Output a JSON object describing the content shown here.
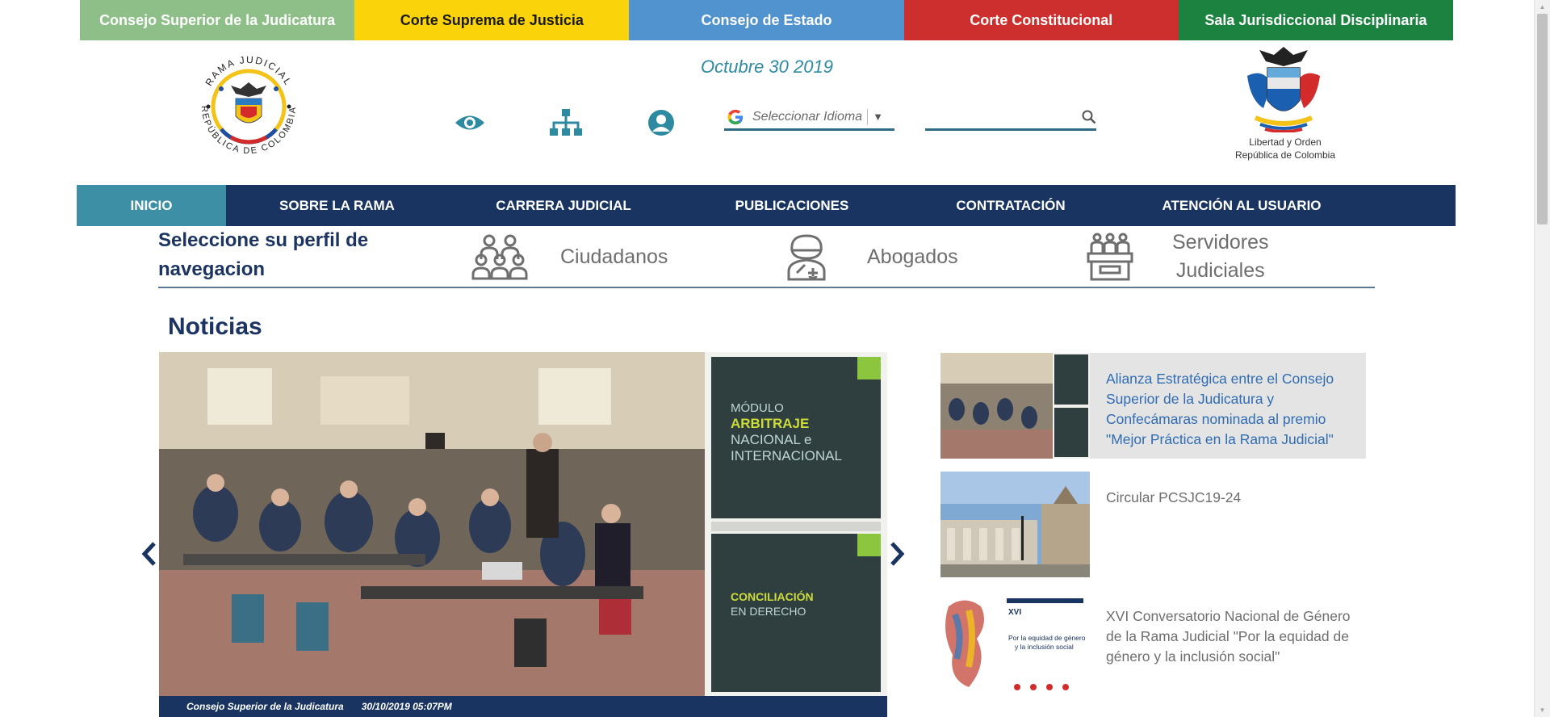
{
  "corp_bar": [
    {
      "label": "Consejo Superior de la Judicatura",
      "color": "#8fbf89"
    },
    {
      "label": "Corte Suprema de Justicia",
      "color": "#fbd30b",
      "text_color": "#1a1a1a"
    },
    {
      "label": "Consejo de Estado",
      "color": "#5193ce"
    },
    {
      "label": "Corte Constitucional",
      "color": "#cc2f2d"
    },
    {
      "label": "Sala Jurisdiccional Disciplinaria",
      "color": "#1b833f"
    }
  ],
  "header": {
    "date": "Octubre 30 2019",
    "left_logo": {
      "name": "rama-judicial-seal",
      "text_top": "RAMA JUDICIAL",
      "text_bottom": "REPÚBLICA DE COLOMBIA"
    },
    "right_logo": {
      "name": "colombia-coat-of-arms",
      "caption_line1": "Libertad y Orden",
      "caption_line2": "República de Colombia"
    },
    "icons": [
      "eye-icon",
      "sitemap-icon",
      "user-icon"
    ],
    "language": {
      "placeholder": "Seleccionar Idioma",
      "arrow": "▼"
    },
    "search": {
      "value": ""
    }
  },
  "nav": {
    "items": [
      {
        "label": "INICIO",
        "active": true
      },
      {
        "label": "SOBRE LA RAMA"
      },
      {
        "label": "CARRERA JUDICIAL"
      },
      {
        "label": "PUBLICACIONES"
      },
      {
        "label": "CONTRATACIÓN"
      },
      {
        "label": "ATENCIÓN AL USUARIO"
      }
    ]
  },
  "profiles": {
    "title_line1": "Seleccione su perfil de",
    "title_line2": "navegacion",
    "items": [
      {
        "label": "Ciudadanos",
        "icon": "citizens-icon"
      },
      {
        "label": "Abogados",
        "icon": "lawyer-icon"
      },
      {
        "label_line1": "Servidores",
        "label_line2": "Judiciales",
        "icon": "judicial-servants-icon"
      }
    ]
  },
  "news": {
    "heading": "Noticias",
    "slider": {
      "book1_line1": "MÓDULO",
      "book1_line2": "ARBITRAJE",
      "book1_line3": "NACIONAL e",
      "book1_line4": "INTERNACIONAL",
      "book2_line1": "CONCILIACIÓN",
      "book2_line2": "EN DERECHO",
      "caption_source": "Consejo Superior de la Judicatura",
      "caption_date": "30/10/2019 05:07PM"
    },
    "items": [
      {
        "title": "Alianza Estratégica entre el Consejo Superior de la Judicatura y Confecámaras nominada al premio \"Mejor Práctica en la Rama Judicial\"",
        "highlighted": true
      },
      {
        "title": "Circular PCSJC19-24"
      },
      {
        "title": "XVI Conversatorio Nacional de Género de la Rama Judicial \"Por la equidad de género y la inclusión social\"",
        "thumb_line1": "Por la equidad de género",
        "thumb_line2": "y la inclusión social"
      }
    ]
  }
}
